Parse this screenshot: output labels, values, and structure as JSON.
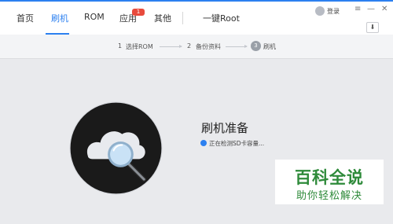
{
  "nav": {
    "tabs": [
      {
        "label": "首页"
      },
      {
        "label": "刷机"
      },
      {
        "label": "ROM"
      },
      {
        "label": "应用",
        "badge": "1"
      },
      {
        "label": "其他"
      },
      {
        "label": "一键Root"
      }
    ],
    "active_tab": "刷机"
  },
  "account": {
    "login_label": "登录"
  },
  "window_controls": {
    "menu": "≡",
    "minimize": "—",
    "close": "✕"
  },
  "download_icon": "⬇",
  "steps": [
    {
      "number": "1",
      "label": "选择ROM"
    },
    {
      "number": "2",
      "label": "备份资料"
    },
    {
      "number": "3",
      "label": "刷机"
    }
  ],
  "main": {
    "title": "刷机准备",
    "status": "正在检测SD卡容量..."
  },
  "watermark": {
    "line1": "百科全说",
    "line2": "助你轻松解决"
  },
  "colors": {
    "accent": "#2c80f0",
    "badge": "#e84a3c",
    "watermark": "#2e8a3a"
  }
}
